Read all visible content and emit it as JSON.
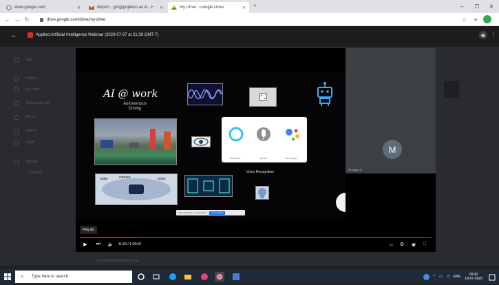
{
  "browser": {
    "tabs": [
      {
        "label": "www.google.com",
        "active": false
      },
      {
        "label": "Report - gm@goptech.ac.in - F",
        "active": false
      },
      {
        "label": "My Drive - Google Drive",
        "active": true
      }
    ],
    "new_tab": "+",
    "address": "drive.google.com/drive/my-drive",
    "window_controls": {
      "minimize": "–",
      "maximize": "☐",
      "close": "✕"
    }
  },
  "meeting": {
    "title": "Applied Artificial Intelligence Webinar (2020-07-07 at 21:39 GMT-7)",
    "back_icon": "arrow-left-icon"
  },
  "slide": {
    "title": "AI @ work",
    "subtitle": "Autonomous\nDriving",
    "voice_label": "Voice Recognition",
    "assistants": [
      "\"Hey Alexa\"",
      "\"Hey Siri\"",
      "\"Hey Google\""
    ]
  },
  "participant": {
    "initial": "M",
    "name": "Murugan G"
  },
  "drive_sidebar": [
    "New",
    "Priority",
    "My Drive",
    "Shared with me",
    "Recent",
    "Starred",
    "Trash",
    "Storage",
    "1 GB used"
  ],
  "mini_dialog": {
    "text": "Video playback is being shared",
    "button": "Stop sharing"
  },
  "player": {
    "tooltip": "Play (k)",
    "current_time": "11:53",
    "duration": "1:09:50",
    "time_display": "11:53 / 1:09:50",
    "progress_fraction": 0.17
  },
  "file_row": "The Automated Webinar Gu",
  "taskbar": {
    "search_placeholder": "Type here to search",
    "language": "ENG",
    "time": "09:42",
    "date": "18-07-2020"
  },
  "colors": {
    "progress": "#ff0000",
    "rec": "#d93025",
    "taskbar": "#1f2a38"
  }
}
